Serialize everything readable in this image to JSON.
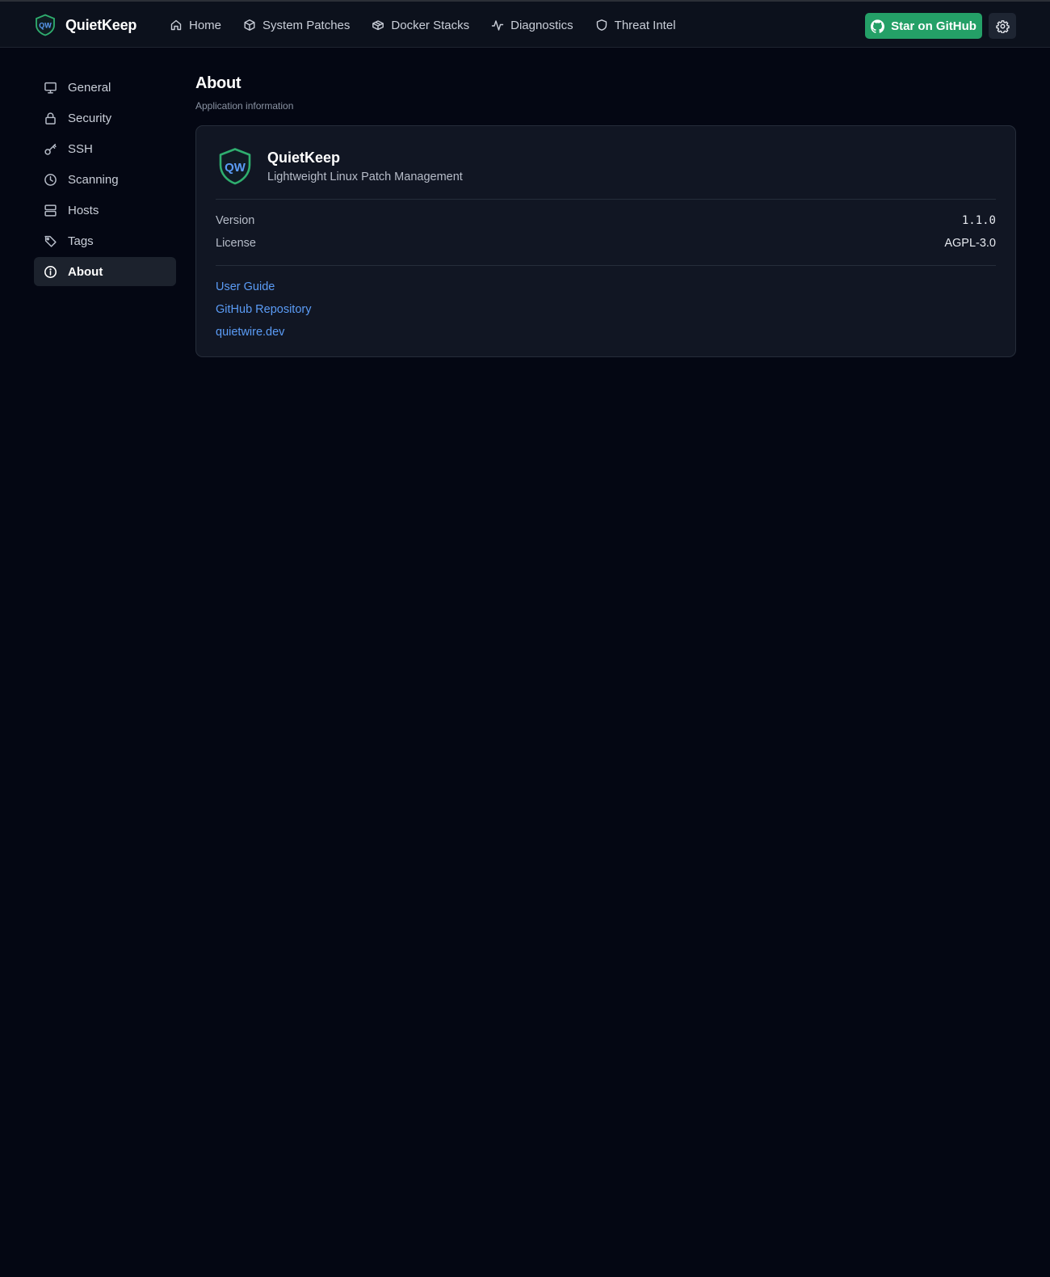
{
  "brand": {
    "name": "QuietKeep",
    "logo_text": "QW",
    "logo_stroke": "#2fae6f",
    "logo_text_color": "#5b9cf6"
  },
  "nav": {
    "items": [
      {
        "label": "Home",
        "icon": "home-icon"
      },
      {
        "label": "System Patches",
        "icon": "package-icon"
      },
      {
        "label": "Docker Stacks",
        "icon": "box-icon"
      },
      {
        "label": "Diagnostics",
        "icon": "activity-icon"
      },
      {
        "label": "Threat Intel",
        "icon": "shield-icon"
      }
    ]
  },
  "header_actions": {
    "star_label": "Star on GitHub",
    "star_color": "#24a067",
    "settings_icon": "gear-icon"
  },
  "sidebar": {
    "items": [
      {
        "label": "General",
        "icon": "monitor-icon",
        "active": false
      },
      {
        "label": "Security",
        "icon": "lock-icon",
        "active": false
      },
      {
        "label": "SSH",
        "icon": "key-icon",
        "active": false
      },
      {
        "label": "Scanning",
        "icon": "clock-icon",
        "active": false
      },
      {
        "label": "Hosts",
        "icon": "server-icon",
        "active": false
      },
      {
        "label": "Tags",
        "icon": "tag-icon",
        "active": false
      },
      {
        "label": "About",
        "icon": "info-icon",
        "active": true
      }
    ]
  },
  "page": {
    "title": "About",
    "subtitle": "Application information"
  },
  "about": {
    "app_name": "QuietKeep",
    "description": "Lightweight Linux Patch Management",
    "version_label": "Version",
    "version_value": "1.1.0",
    "license_label": "License",
    "license_value": "AGPL-3.0",
    "links": [
      {
        "label": "User Guide"
      },
      {
        "label": "GitHub Repository"
      },
      {
        "label": "quietwire.dev"
      }
    ],
    "link_color": "#5b9cf6"
  }
}
